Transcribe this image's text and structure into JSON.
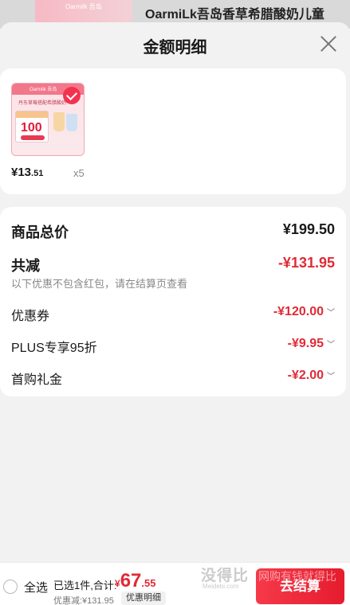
{
  "background": {
    "thumb_brand": "Oarmilk 吾岛",
    "product_title": "OarmiLk吾岛香草希腊酸奶儿童"
  },
  "sheet": {
    "title": "金额明细",
    "close_icon": "close-icon"
  },
  "product": {
    "thumb_brand": "Oarmilk 吾岛",
    "thumb_headline": "丹东草莓搭配希腊酸奶",
    "thumb_coupon_value": "100",
    "selected": true,
    "price_int": "¥13",
    "price_dec": ".51",
    "quantity": "x5"
  },
  "summary": {
    "subtotal_label": "商品总价",
    "subtotal_value": "¥199.50",
    "discount_label": "共减",
    "discount_value": "-¥131.95",
    "discount_note": "以下优惠不包含红包，请在结算页查看",
    "items": [
      {
        "label": "优惠券",
        "value": "-¥120.00"
      },
      {
        "label": "PLUS专享95折",
        "value": "-¥9.95"
      },
      {
        "label": "首购礼金",
        "value": "-¥2.00"
      }
    ]
  },
  "bottom_bar": {
    "select_all_label": "全选",
    "selected_count_text": "已选1件,合计:",
    "total_symbol": "¥",
    "total_int": "67",
    "total_dec": ".55",
    "saved_text": "优惠减:¥131.95",
    "detail_button": "优惠明细",
    "checkout_button": "去结算"
  },
  "watermark": {
    "main": "没得比",
    "sub": "Meidebi.com",
    "slogan": "网购有钱就得比"
  },
  "colors": {
    "accent_red": "#e02a36",
    "checkout_red": "#e51c2e"
  }
}
